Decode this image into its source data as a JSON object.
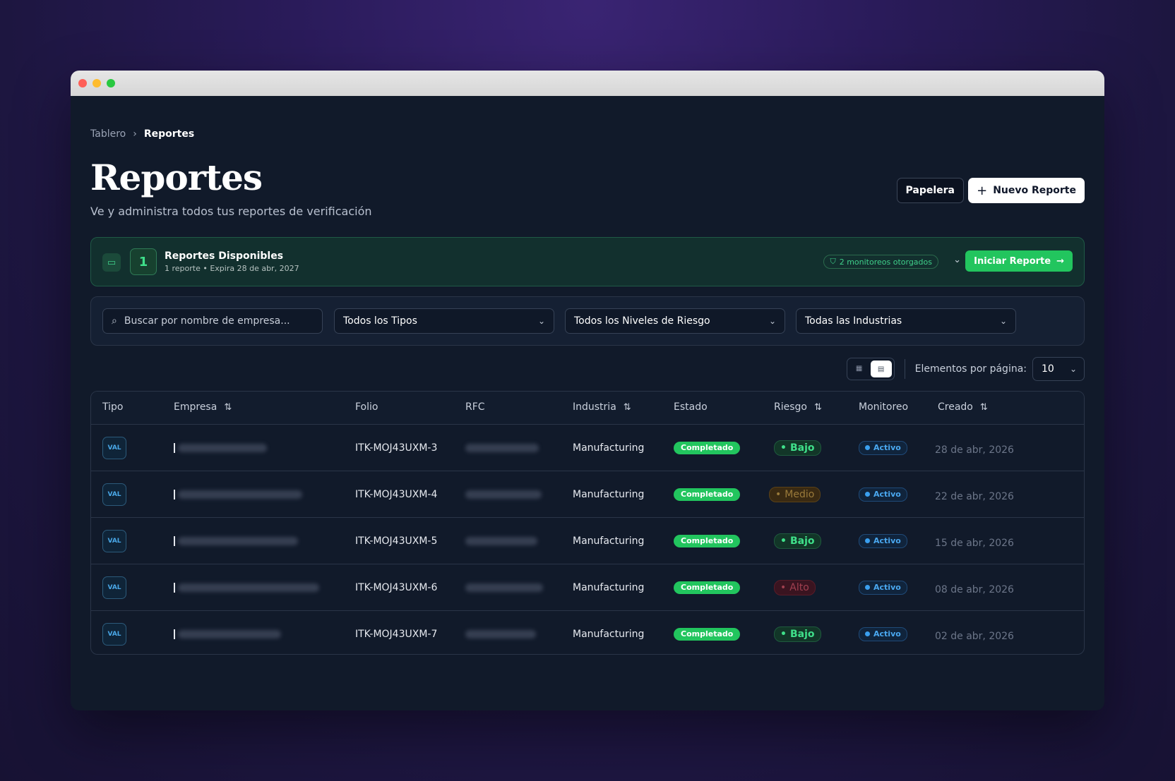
{
  "breadcrumb": {
    "root": "Tablero",
    "separator": "›",
    "current": "Reportes"
  },
  "header": {
    "title": "Reportes",
    "subtitle": "Ve y administra todos tus reportes de verificación",
    "trash_label": "Papelera",
    "new_label": "Nuevo Reporte",
    "new_icon": "plus-icon"
  },
  "credits": {
    "count": "1",
    "title": "Reportes Disponibles",
    "subtitle": "1 reporte • Expira 28 de abr, 2027",
    "monitoring": "2 monitoreos otorgados",
    "start_label": "Iniciar Reporte"
  },
  "filters": {
    "search_placeholder": "Buscar por nombre de empresa...",
    "type": "Todos los Tipos",
    "risk": "Todos los Niveles de Riesgo",
    "industry": "Todas las Industrias"
  },
  "pagination": {
    "per_page_label": "Elementos por página:",
    "per_page": "10"
  },
  "table": {
    "columns": [
      "Tipo",
      "Empresa",
      "Folio",
      "RFC",
      "Industria",
      "Estado",
      "Riesgo",
      "Monitoreo",
      "Creado"
    ],
    "rows": [
      {
        "tipo": "VAL",
        "folio": "ITK-MOJ43UXM-3",
        "industria": "Manufacturing",
        "estado": "Completado",
        "riesgo": "Bajo",
        "riesgo_level": "low",
        "monitoreo": "Activo",
        "creado": "28 de abr, 2026"
      },
      {
        "tipo": "VAL",
        "folio": "ITK-MOJ43UXM-4",
        "industria": "Manufacturing",
        "estado": "Completado",
        "riesgo": "Medio",
        "riesgo_level": "mid",
        "monitoreo": "Activo",
        "creado": "22 de abr, 2026"
      },
      {
        "tipo": "VAL",
        "folio": "ITK-MOJ43UXM-5",
        "industria": "Manufacturing",
        "estado": "Completado",
        "riesgo": "Bajo",
        "riesgo_level": "low",
        "monitoreo": "Activo",
        "creado": "15 de abr, 2026"
      },
      {
        "tipo": "VAL",
        "folio": "ITK-MOJ43UXM-6",
        "industria": "Manufacturing",
        "estado": "Completado",
        "riesgo": "Alto",
        "riesgo_level": "high",
        "monitoreo": "Activo",
        "creado": "08 de abr, 2026"
      },
      {
        "tipo": "VAL",
        "folio": "ITK-MOJ43UXM-7",
        "industria": "Manufacturing",
        "estado": "Completado",
        "riesgo": "Bajo",
        "riesgo_level": "low",
        "monitoreo": "Activo",
        "creado": "02 de abr, 2026"
      }
    ]
  },
  "colors": {
    "accent": "#22c55e",
    "background": "#111a2a",
    "info": "#3aa0f0"
  }
}
